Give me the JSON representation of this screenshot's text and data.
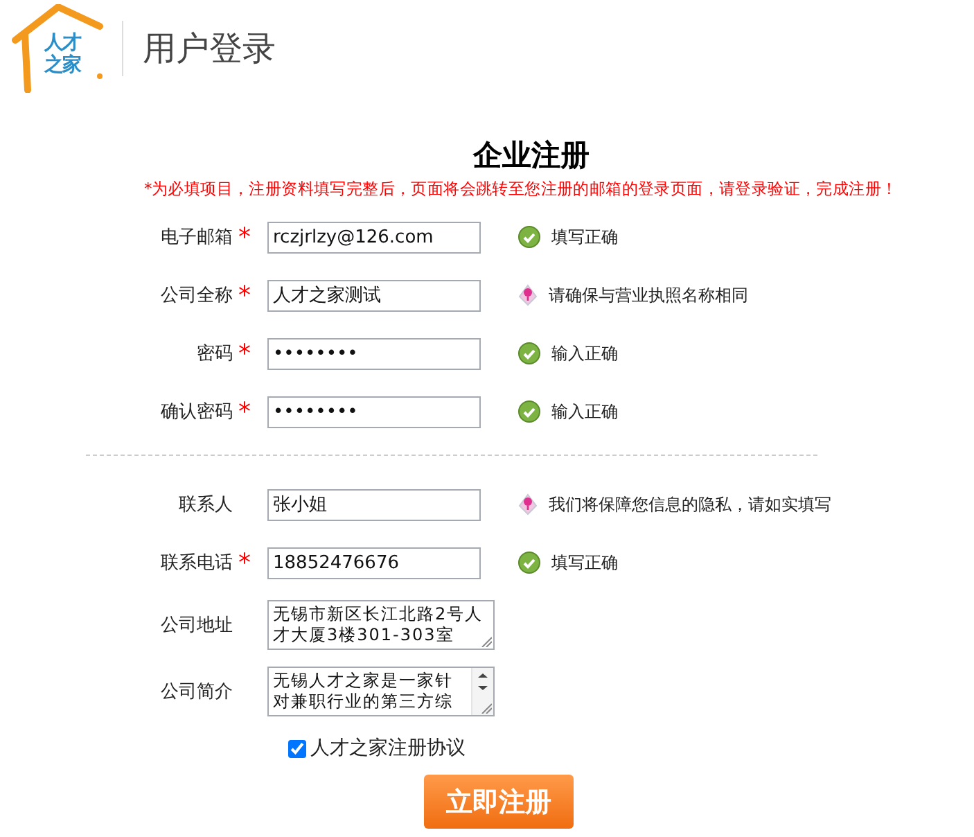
{
  "header": {
    "logo_text": "人才之家",
    "title": "用户登录"
  },
  "form": {
    "title": "企业注册",
    "note": "*为必填项目，注册资料填写完整后，页面将会跳转至您注册的邮箱的登录页面，请登录验证，完成注册！",
    "fields": [
      {
        "label": "电子邮箱",
        "required_mark": "*",
        "kind": "text",
        "value": "rczjrlzy@126.com",
        "hint": {
          "kind": "ok",
          "text": "填写正确"
        }
      },
      {
        "label": "公司全称",
        "required_mark": "*",
        "kind": "text",
        "value": "人才之家测试",
        "hint": {
          "kind": "info",
          "text": "请确保与营业执照名称相同"
        }
      },
      {
        "label": "密码",
        "required_mark": "*",
        "kind": "text",
        "value": "••••••••",
        "hint": {
          "kind": "ok",
          "text": "输入正确"
        }
      },
      {
        "label": "确认密码",
        "required_mark": "*",
        "kind": "text",
        "value": "••••••••",
        "hint": {
          "kind": "ok",
          "text": "输入正确"
        }
      },
      {
        "kind": "divider"
      },
      {
        "label": "联系人",
        "kind": "text",
        "value": "张小姐",
        "hint": {
          "kind": "info",
          "text": "我们将保障您信息的隐私，请如实填写"
        }
      },
      {
        "label": "联系电话",
        "required_mark": "*",
        "kind": "text",
        "value": "18852476676",
        "hint": {
          "kind": "ok",
          "text": "填写正确"
        }
      },
      {
        "label": "公司地址",
        "kind": "textarea",
        "value": "无锡市新区长江北路2号人才大厦3楼301-303室"
      },
      {
        "label": "公司简介",
        "kind": "scrollarea",
        "value": "无锡人才之家是一家针对兼职行业的第三方综"
      }
    ],
    "agreement": {
      "label": "人才之家注册协议",
      "checked": true
    },
    "submit": "立即注册"
  }
}
